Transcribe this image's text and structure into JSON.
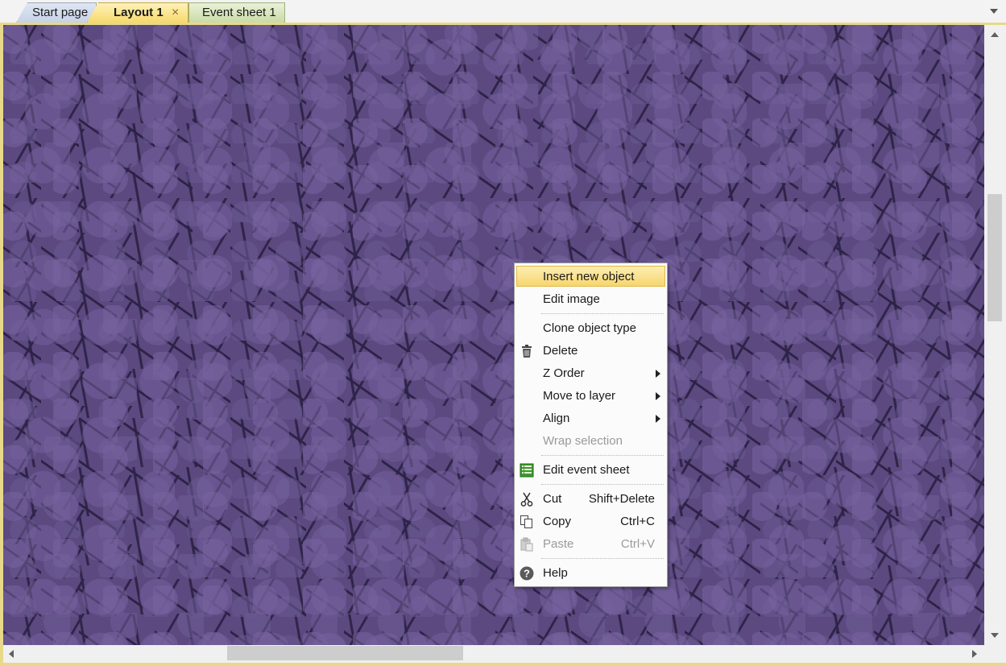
{
  "tabs": [
    {
      "label": "Start page"
    },
    {
      "label": "Layout 1"
    },
    {
      "label": "Event sheet 1"
    }
  ],
  "close_glyph": "×",
  "context_menu": {
    "items": [
      {
        "label": "Insert new object",
        "highlighted": true
      },
      {
        "label": "Edit image"
      },
      {
        "label": "Clone object type"
      },
      {
        "label": "Delete",
        "icon": "trash-icon"
      },
      {
        "label": "Z Order",
        "submenu": true
      },
      {
        "label": "Move to layer",
        "submenu": true
      },
      {
        "label": "Align",
        "submenu": true
      },
      {
        "label": "Wrap selection",
        "disabled": true
      },
      {
        "label": "Edit event sheet",
        "icon": "event-sheet-icon"
      },
      {
        "label": "Cut",
        "shortcut": "Shift+Delete",
        "icon": "scissors-icon"
      },
      {
        "label": "Copy",
        "shortcut": "Ctrl+C",
        "icon": "copy-icon"
      },
      {
        "label": "Paste",
        "shortcut": "Ctrl+V",
        "icon": "paste-icon",
        "disabled": true
      },
      {
        "label": "Help",
        "icon": "help-icon"
      }
    ]
  },
  "colors": {
    "layout_background": "#5b4980",
    "menu_highlight": "#f6d66e"
  }
}
